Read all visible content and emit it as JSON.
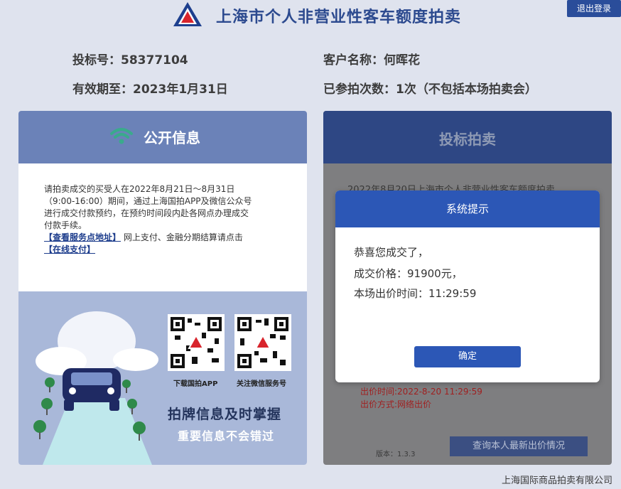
{
  "header": {
    "title": "上海市个人非营业性客车额度拍卖",
    "logout_label": "退出登录"
  },
  "info": {
    "bid_number_label": "投标号：58377104",
    "customer_label": "客户名称：何晖花",
    "valid_until_label": "有效期至：2023年1月31日",
    "participated_label": "已参拍次数：1次（不包括本场拍卖会）"
  },
  "left_panel": {
    "title": "公开信息",
    "notice_lines": [
      "请拍卖成交的买受人在2022年8月21日～8月31日",
      "（9:00-16:00）期间，通过上海国拍APP及微信公众号",
      "进行成交付款预约，在预约时间段内赴各网点办理成交",
      "付款手续。"
    ],
    "service_link": "【查看服务点地址】",
    "notice_mid": " 网上支付、金融分期结算请点击",
    "online_pay_link": "【在线支付】",
    "qr_app_label": "下载国拍APP",
    "qr_wechat_label": "关注微信服务号",
    "slogan_main": "拍牌信息及时掌握",
    "slogan_sub": "重要信息不会错过"
  },
  "right_panel": {
    "title": "投标拍卖",
    "behind_line": "2022年8月20日上海市个人非营业性客车额度拍卖",
    "bid_time": "出价时间:2022-8-20 11:29:59",
    "bid_method": "出价方式:网络出价",
    "version": "版本：1.3.3",
    "query_button": "查询本人最新出价情况"
  },
  "dialog": {
    "title": "系统提示",
    "line1": "恭喜您成交了，",
    "line2": "成交价格：91900元，",
    "line3": "本场出价时间：11:29:59",
    "confirm_label": "确定"
  },
  "footer": {
    "company": "上海国际商品拍卖有限公司"
  },
  "colors": {
    "brand_blue": "#2c57b6",
    "header_text": "#2c4a8f",
    "accent_green": "#3aaa8c"
  }
}
